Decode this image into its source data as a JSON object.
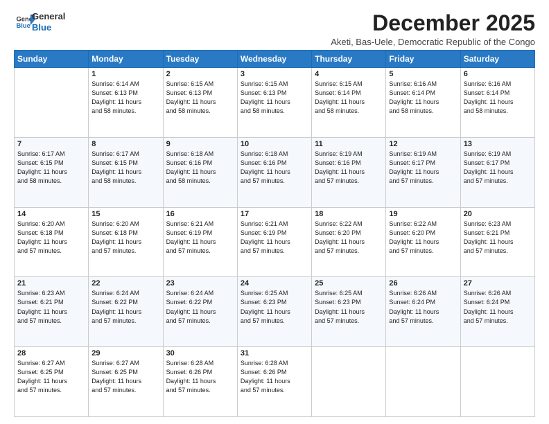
{
  "logo": {
    "general": "General",
    "blue": "Blue"
  },
  "title": "December 2025",
  "subtitle": "Aketi, Bas-Uele, Democratic Republic of the Congo",
  "days_of_week": [
    "Sunday",
    "Monday",
    "Tuesday",
    "Wednesday",
    "Thursday",
    "Friday",
    "Saturday"
  ],
  "weeks": [
    [
      {
        "day": "",
        "info": ""
      },
      {
        "day": "1",
        "info": "Sunrise: 6:14 AM\nSunset: 6:13 PM\nDaylight: 11 hours\nand 58 minutes."
      },
      {
        "day": "2",
        "info": "Sunrise: 6:15 AM\nSunset: 6:13 PM\nDaylight: 11 hours\nand 58 minutes."
      },
      {
        "day": "3",
        "info": "Sunrise: 6:15 AM\nSunset: 6:13 PM\nDaylight: 11 hours\nand 58 minutes."
      },
      {
        "day": "4",
        "info": "Sunrise: 6:15 AM\nSunset: 6:14 PM\nDaylight: 11 hours\nand 58 minutes."
      },
      {
        "day": "5",
        "info": "Sunrise: 6:16 AM\nSunset: 6:14 PM\nDaylight: 11 hours\nand 58 minutes."
      },
      {
        "day": "6",
        "info": "Sunrise: 6:16 AM\nSunset: 6:14 PM\nDaylight: 11 hours\nand 58 minutes."
      }
    ],
    [
      {
        "day": "7",
        "info": "Sunrise: 6:17 AM\nSunset: 6:15 PM\nDaylight: 11 hours\nand 58 minutes."
      },
      {
        "day": "8",
        "info": "Sunrise: 6:17 AM\nSunset: 6:15 PM\nDaylight: 11 hours\nand 58 minutes."
      },
      {
        "day": "9",
        "info": "Sunrise: 6:18 AM\nSunset: 6:16 PM\nDaylight: 11 hours\nand 58 minutes."
      },
      {
        "day": "10",
        "info": "Sunrise: 6:18 AM\nSunset: 6:16 PM\nDaylight: 11 hours\nand 57 minutes."
      },
      {
        "day": "11",
        "info": "Sunrise: 6:19 AM\nSunset: 6:16 PM\nDaylight: 11 hours\nand 57 minutes."
      },
      {
        "day": "12",
        "info": "Sunrise: 6:19 AM\nSunset: 6:17 PM\nDaylight: 11 hours\nand 57 minutes."
      },
      {
        "day": "13",
        "info": "Sunrise: 6:19 AM\nSunset: 6:17 PM\nDaylight: 11 hours\nand 57 minutes."
      }
    ],
    [
      {
        "day": "14",
        "info": "Sunrise: 6:20 AM\nSunset: 6:18 PM\nDaylight: 11 hours\nand 57 minutes."
      },
      {
        "day": "15",
        "info": "Sunrise: 6:20 AM\nSunset: 6:18 PM\nDaylight: 11 hours\nand 57 minutes."
      },
      {
        "day": "16",
        "info": "Sunrise: 6:21 AM\nSunset: 6:19 PM\nDaylight: 11 hours\nand 57 minutes."
      },
      {
        "day": "17",
        "info": "Sunrise: 6:21 AM\nSunset: 6:19 PM\nDaylight: 11 hours\nand 57 minutes."
      },
      {
        "day": "18",
        "info": "Sunrise: 6:22 AM\nSunset: 6:20 PM\nDaylight: 11 hours\nand 57 minutes."
      },
      {
        "day": "19",
        "info": "Sunrise: 6:22 AM\nSunset: 6:20 PM\nDaylight: 11 hours\nand 57 minutes."
      },
      {
        "day": "20",
        "info": "Sunrise: 6:23 AM\nSunset: 6:21 PM\nDaylight: 11 hours\nand 57 minutes."
      }
    ],
    [
      {
        "day": "21",
        "info": "Sunrise: 6:23 AM\nSunset: 6:21 PM\nDaylight: 11 hours\nand 57 minutes."
      },
      {
        "day": "22",
        "info": "Sunrise: 6:24 AM\nSunset: 6:22 PM\nDaylight: 11 hours\nand 57 minutes."
      },
      {
        "day": "23",
        "info": "Sunrise: 6:24 AM\nSunset: 6:22 PM\nDaylight: 11 hours\nand 57 minutes."
      },
      {
        "day": "24",
        "info": "Sunrise: 6:25 AM\nSunset: 6:23 PM\nDaylight: 11 hours\nand 57 minutes."
      },
      {
        "day": "25",
        "info": "Sunrise: 6:25 AM\nSunset: 6:23 PM\nDaylight: 11 hours\nand 57 minutes."
      },
      {
        "day": "26",
        "info": "Sunrise: 6:26 AM\nSunset: 6:24 PM\nDaylight: 11 hours\nand 57 minutes."
      },
      {
        "day": "27",
        "info": "Sunrise: 6:26 AM\nSunset: 6:24 PM\nDaylight: 11 hours\nand 57 minutes."
      }
    ],
    [
      {
        "day": "28",
        "info": "Sunrise: 6:27 AM\nSunset: 6:25 PM\nDaylight: 11 hours\nand 57 minutes."
      },
      {
        "day": "29",
        "info": "Sunrise: 6:27 AM\nSunset: 6:25 PM\nDaylight: 11 hours\nand 57 minutes."
      },
      {
        "day": "30",
        "info": "Sunrise: 6:28 AM\nSunset: 6:26 PM\nDaylight: 11 hours\nand 57 minutes."
      },
      {
        "day": "31",
        "info": "Sunrise: 6:28 AM\nSunset: 6:26 PM\nDaylight: 11 hours\nand 57 minutes."
      },
      {
        "day": "",
        "info": ""
      },
      {
        "day": "",
        "info": ""
      },
      {
        "day": "",
        "info": ""
      }
    ]
  ]
}
